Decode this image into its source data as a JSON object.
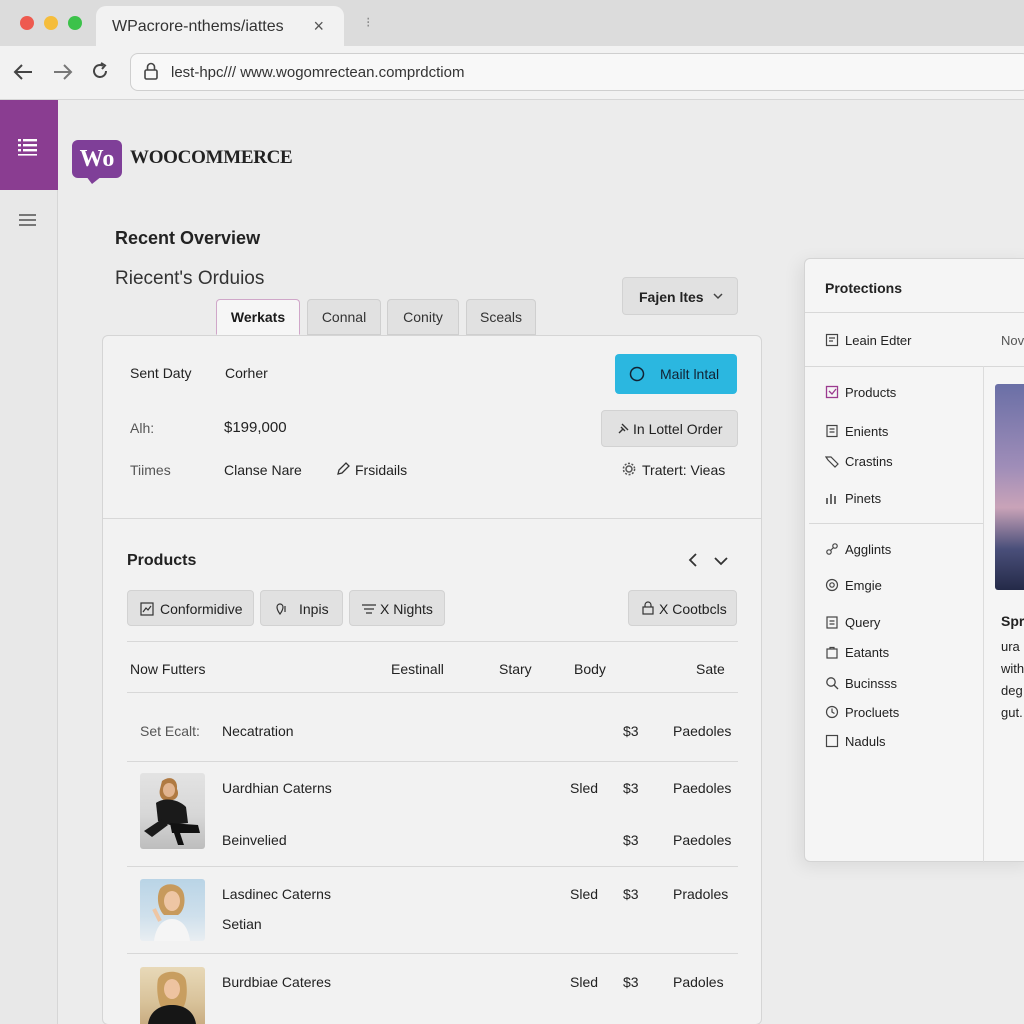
{
  "browser": {
    "tab_title": "WPacrore-nthems/iattes",
    "tab_close": "×",
    "tab_sep": "⁝",
    "url": "lest-hpc/// www.wogomrectean.comprdctiom"
  },
  "brand": {
    "badge": "Wo",
    "name": "WOOCOMMERCE"
  },
  "overview": {
    "title": "Recent Overview",
    "subtitle": "Riecent's Orduios",
    "tabs": [
      "Werkats",
      "Connal",
      "Conity",
      "Sceals"
    ],
    "filter_button": "Fajen ltes"
  },
  "order_summary": {
    "sent_label": "Sent Daty",
    "sent_value": "Corher",
    "primary_button": "Mailt lntal",
    "amount_label": "Alh:",
    "amount_value": "$199,000",
    "order_button": "In Lottel Order",
    "times_label": "Tiimes",
    "name_value": "Clanse Nare",
    "details_link": "Frsidails",
    "views_link": "Tratert: Vieas"
  },
  "products": {
    "title": "Products",
    "filters": [
      "Conformidive",
      "Inpis",
      "X Nights"
    ],
    "controls_button": "X Cootbcls",
    "columns": [
      "Now Futters",
      "Eestinall",
      "Stary",
      "Body",
      "Sate"
    ],
    "first_row": {
      "label": "Set Ecalt:",
      "name": "Necatration",
      "price": "$3",
      "sale": "Paedoles"
    },
    "rows": [
      {
        "name": "Uardhian Caterns",
        "sub": "Beinvelied",
        "stary": "Sled",
        "price": "$3",
        "sale": "Paedoles",
        "sub_price": "$3",
        "sub_sale": "Paedoles"
      },
      {
        "name": "Lasdinec Caterns",
        "sub": "Setian",
        "stary": "Sled",
        "price": "$3",
        "sale": "Pradoles"
      },
      {
        "name": "Burdbiae Cateres",
        "sub": "",
        "stary": "Sled",
        "price": "$3",
        "sale": "Padoles"
      }
    ]
  },
  "right_panel": {
    "title": "Protections",
    "header_item": "Leain Edter",
    "header_extra": "Nov",
    "items": [
      "Products",
      "Enients",
      "Crastins",
      "Pinets",
      "Agglints",
      "Emgie",
      "Query",
      "Eatants",
      "Bucinsss",
      "Procluets",
      "Naduls"
    ],
    "side_text": [
      "Spr",
      "ura",
      "with",
      "deg",
      "gut."
    ]
  },
  "colors": {
    "accent": "#8a3d91",
    "primary": "#2bb7e0"
  }
}
